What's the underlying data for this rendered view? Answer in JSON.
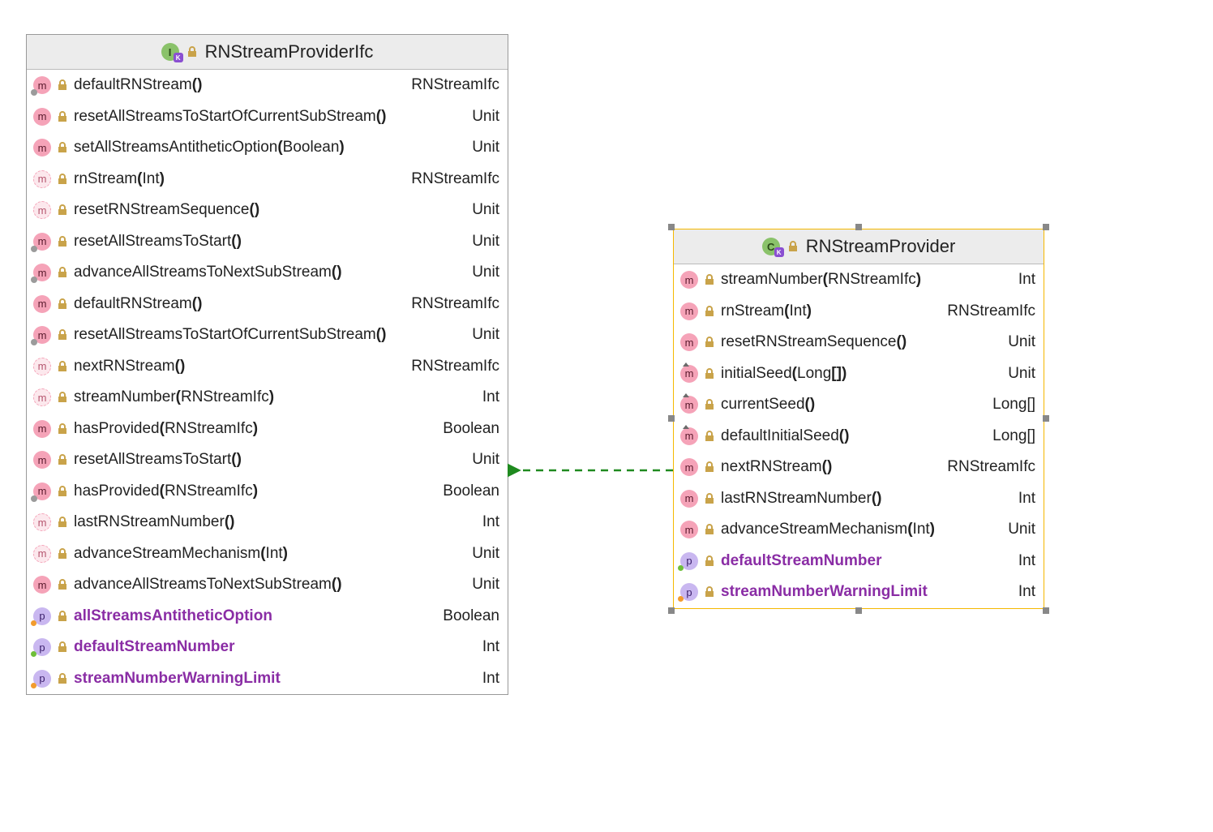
{
  "left_class": {
    "name": "RNStreamProviderIfc",
    "type_icon": "I",
    "members": [
      {
        "kind": "m",
        "variant": "key",
        "sig": "defaultRNStream()",
        "ret": "RNStreamIfc"
      },
      {
        "kind": "m",
        "variant": "",
        "sig": "resetAllStreamsToStartOfCurrentSubStream()",
        "ret": "Unit"
      },
      {
        "kind": "m",
        "variant": "",
        "sig": "setAllStreamsAntitheticOption(Boolean)",
        "ret": "Unit"
      },
      {
        "kind": "m",
        "variant": "abstract",
        "sig": "rnStream(Int)",
        "ret": "RNStreamIfc"
      },
      {
        "kind": "m",
        "variant": "abstract",
        "sig": "resetRNStreamSequence()",
        "ret": "Unit"
      },
      {
        "kind": "m",
        "variant": "key",
        "sig": "resetAllStreamsToStart()",
        "ret": "Unit"
      },
      {
        "kind": "m",
        "variant": "key",
        "sig": "advanceAllStreamsToNextSubStream()",
        "ret": "Unit"
      },
      {
        "kind": "m",
        "variant": "",
        "sig": "defaultRNStream()",
        "ret": "RNStreamIfc"
      },
      {
        "kind": "m",
        "variant": "key",
        "sig": "resetAllStreamsToStartOfCurrentSubStream()",
        "ret": "Unit"
      },
      {
        "kind": "m",
        "variant": "abstract",
        "sig": "nextRNStream()",
        "ret": "RNStreamIfc"
      },
      {
        "kind": "m",
        "variant": "abstract",
        "sig": "streamNumber(RNStreamIfc)",
        "ret": "Int"
      },
      {
        "kind": "m",
        "variant": "",
        "sig": "hasProvided(RNStreamIfc)",
        "ret": "Boolean"
      },
      {
        "kind": "m",
        "variant": "",
        "sig": "resetAllStreamsToStart()",
        "ret": "Unit"
      },
      {
        "kind": "m",
        "variant": "key",
        "sig": "hasProvided(RNStreamIfc)",
        "ret": "Boolean"
      },
      {
        "kind": "m",
        "variant": "abstract",
        "sig": "lastRNStreamNumber()",
        "ret": "Int"
      },
      {
        "kind": "m",
        "variant": "abstract",
        "sig": "advanceStreamMechanism(Int)",
        "ret": "Unit"
      },
      {
        "kind": "m",
        "variant": "",
        "sig": "advanceAllStreamsToNextSubStream()",
        "ret": "Unit"
      },
      {
        "kind": "p",
        "variant": "dot-orange",
        "sig": "allStreamsAntitheticOption",
        "ret": "Boolean"
      },
      {
        "kind": "p",
        "variant": "dot-green",
        "sig": "defaultStreamNumber",
        "ret": "Int"
      },
      {
        "kind": "p",
        "variant": "dot-orange",
        "sig": "streamNumberWarningLimit",
        "ret": "Int"
      }
    ]
  },
  "right_class": {
    "name": "RNStreamProvider",
    "type_icon": "C",
    "members": [
      {
        "kind": "m",
        "variant": "",
        "sig": "streamNumber(RNStreamIfc)",
        "ret": "Int"
      },
      {
        "kind": "m",
        "variant": "",
        "sig": "rnStream(Int)",
        "ret": "RNStreamIfc"
      },
      {
        "kind": "m",
        "variant": "",
        "sig": "resetRNStreamSequence()",
        "ret": "Unit"
      },
      {
        "kind": "m",
        "variant": "override",
        "sig": "initialSeed(Long[])",
        "ret": "Unit"
      },
      {
        "kind": "m",
        "variant": "override",
        "sig": "currentSeed()",
        "ret": "Long[]"
      },
      {
        "kind": "m",
        "variant": "override",
        "sig": "defaultInitialSeed()",
        "ret": "Long[]"
      },
      {
        "kind": "m",
        "variant": "",
        "sig": "nextRNStream()",
        "ret": "RNStreamIfc"
      },
      {
        "kind": "m",
        "variant": "",
        "sig": "lastRNStreamNumber()",
        "ret": "Int"
      },
      {
        "kind": "m",
        "variant": "",
        "sig": "advanceStreamMechanism(Int)",
        "ret": "Unit"
      },
      {
        "kind": "p",
        "variant": "dot-green",
        "sig": "defaultStreamNumber",
        "ret": "Int"
      },
      {
        "kind": "p",
        "variant": "dot-orange",
        "sig": "streamNumberWarningLimit",
        "ret": "Int"
      }
    ]
  }
}
